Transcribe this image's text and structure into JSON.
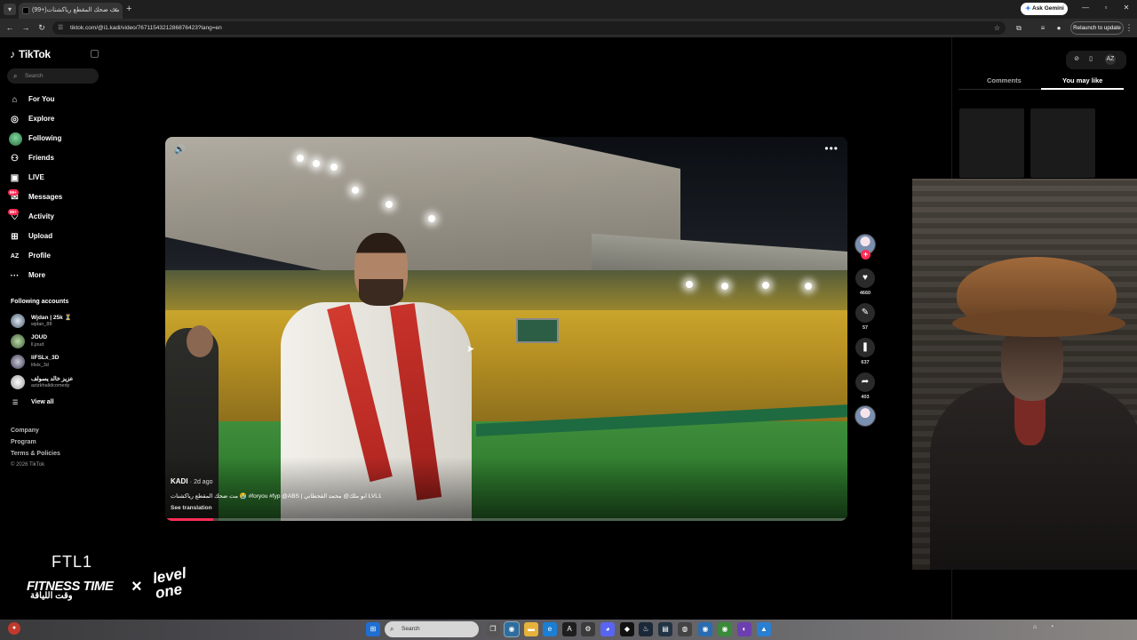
{
  "browser": {
    "tab_title": "(99+)مت ضحك المقطع رياكشنات",
    "url": "tiktok.com/@i1.kadi/video/7671154321286876423?lang=en",
    "ask_gemini": "Ask Gemini",
    "relaunch": "Relaunch to update"
  },
  "sidebar": {
    "logo": "TikTok",
    "search_placeholder": "Search",
    "items": [
      {
        "label": "For You",
        "icon": "home-icon"
      },
      {
        "label": "Explore",
        "icon": "compass-icon"
      },
      {
        "label": "Following",
        "icon": "following-avatar"
      },
      {
        "label": "Friends",
        "icon": "friends-icon"
      },
      {
        "label": "LIVE",
        "icon": "live-icon"
      },
      {
        "label": "Messages",
        "icon": "messages-icon",
        "badge": "99+"
      },
      {
        "label": "Activity",
        "icon": "activity-icon",
        "badge": "99+"
      },
      {
        "label": "Upload",
        "icon": "upload-icon"
      },
      {
        "label": "Profile",
        "icon": "profile-icon"
      },
      {
        "label": "More",
        "icon": "more-icon"
      }
    ],
    "following_accounts_title": "Following accounts",
    "accounts": [
      {
        "name": "Wjdan | 25k ⏳",
        "handle": "wjdan_88"
      },
      {
        "name": "JOUD",
        "handle": "ll.joud"
      },
      {
        "name": "liFSLx_3D",
        "handle": "lifslx_3d"
      },
      {
        "name": "عزيز خالد يسولف",
        "handle": "azizkhalidcomedy"
      }
    ],
    "view_all": "View all",
    "footer": [
      "Company",
      "Program",
      "Terms & Policies"
    ],
    "copyright": "© 2026 TikTok"
  },
  "video": {
    "author": "KADI",
    "posted": "· 2d ago",
    "caption": "مت ضحك المقطع رياكشنات 😭 #foryou #fyp @ABS | ابو ملك@ محمد القحطاني LVL1",
    "see_translation": "See translation",
    "progress": 0.07
  },
  "actions": {
    "likes": "4660",
    "comments": "57",
    "saves": "637",
    "shares": "403"
  },
  "right_panel": {
    "tabs": [
      "Comments",
      "You may like"
    ],
    "active_tab": "You may like"
  },
  "branding": {
    "ftl": "FTL1",
    "fitness": "FITNESS TIME",
    "fitness_ar": "وقت اللياقة",
    "x": "×",
    "level_one": "level one"
  },
  "taskbar": {
    "search_placeholder": "Search"
  },
  "colors": {
    "accent": "#fe2c55",
    "background": "#000000"
  }
}
